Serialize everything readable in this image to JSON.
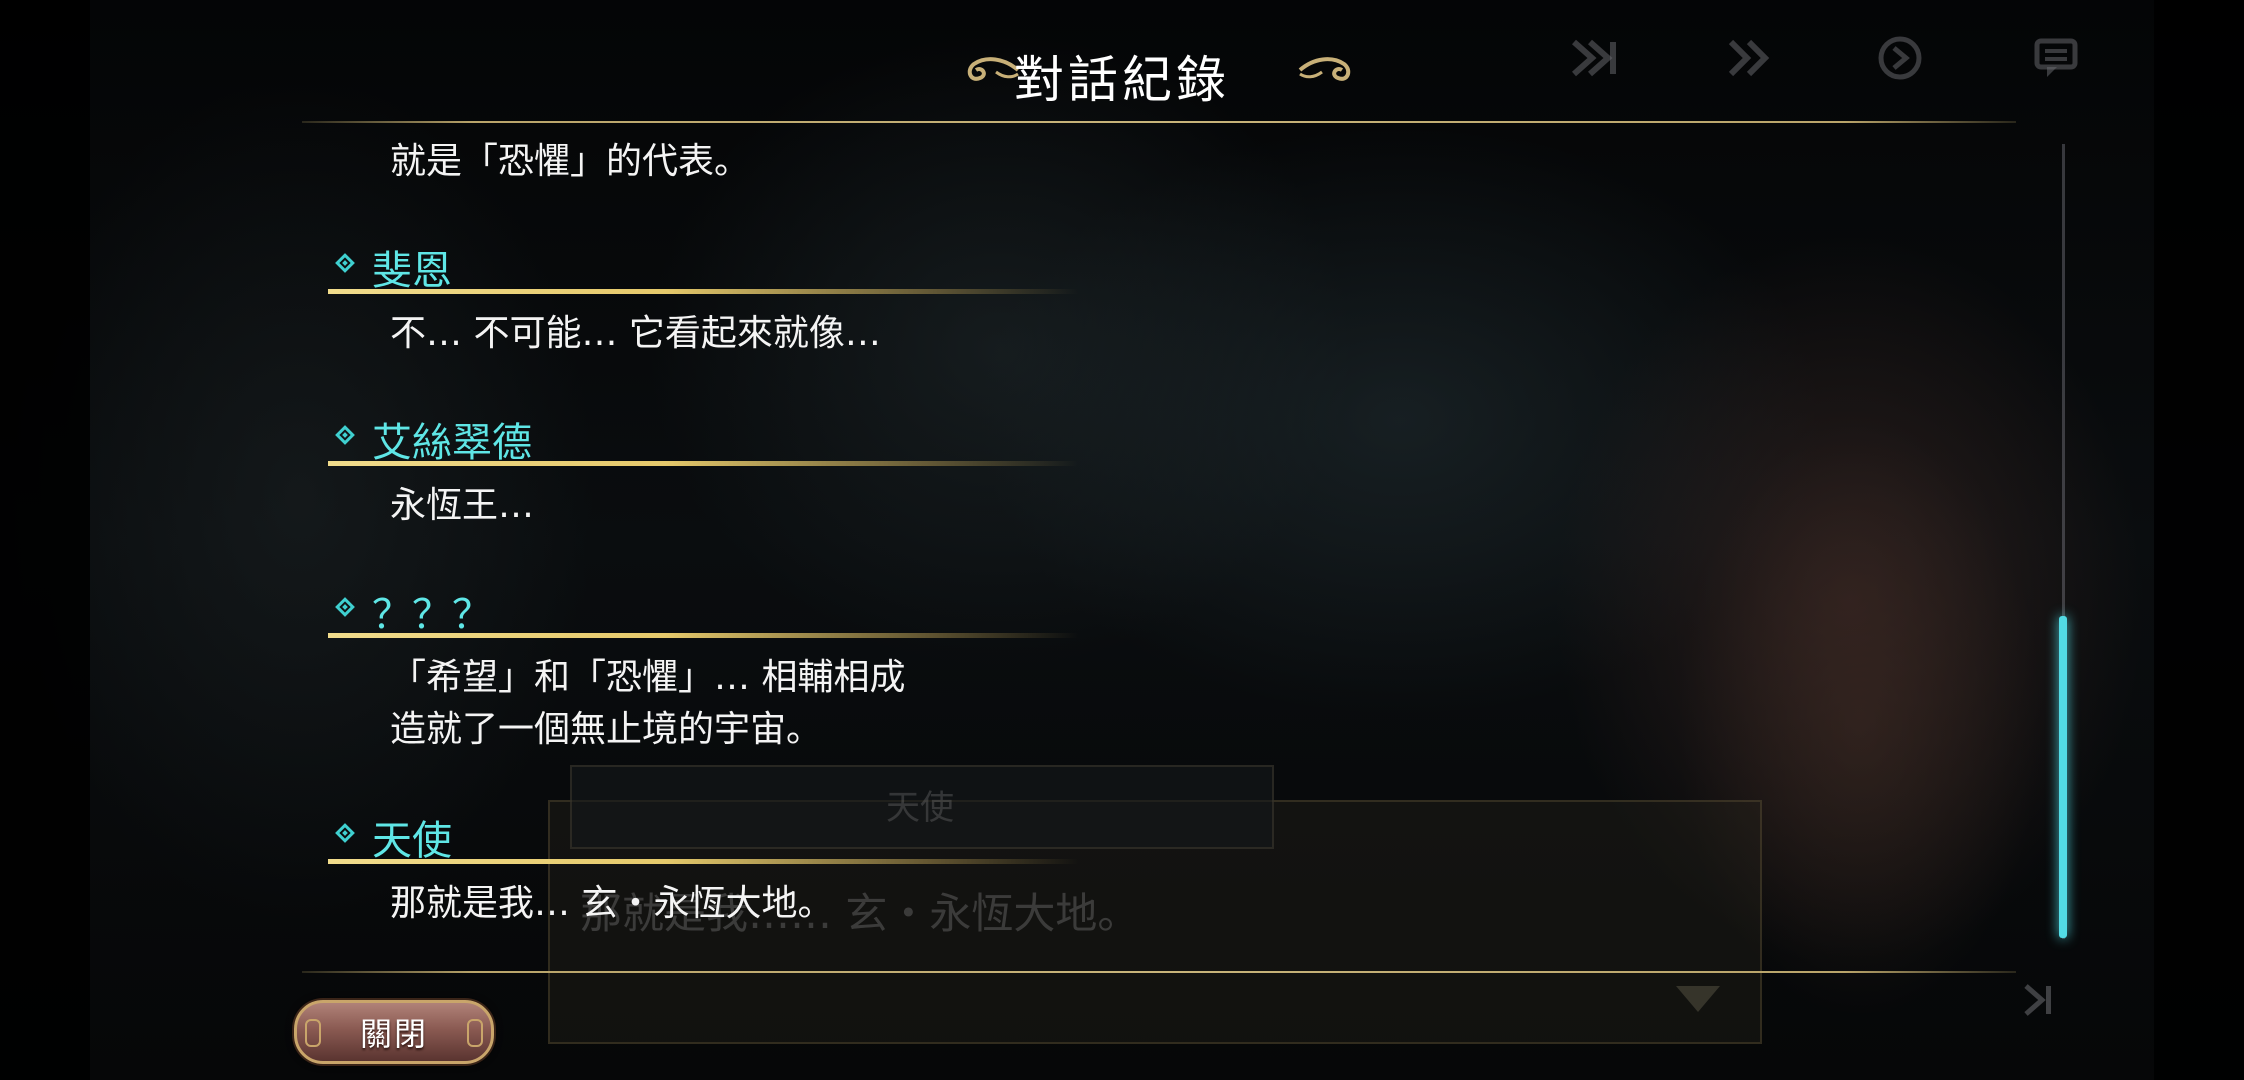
{
  "header": {
    "title": "對話紀錄"
  },
  "background_dialog": {
    "speaker": "天使",
    "text": "那就是我…… 玄・永恆大地。"
  },
  "top_controls": [
    {
      "icon": "fast-forward-icon",
      "glyph": "⏭"
    },
    {
      "icon": "skip-forward-icon",
      "glyph": "»"
    },
    {
      "icon": "auto-play-icon",
      "glyph": "⟳"
    },
    {
      "icon": "log-icon",
      "glyph": "☰"
    }
  ],
  "log": {
    "entries": [
      {
        "speaker": "",
        "lines": [
          "就是「恐懼」的代表。"
        ]
      },
      {
        "speaker": "斐恩",
        "lines": [
          "不… 不可能… 它看起來就像…"
        ]
      },
      {
        "speaker": "艾絲翠德",
        "lines": [
          "永恆王…"
        ]
      },
      {
        "speaker": "？？？",
        "lines": [
          "「希望」和「恐懼」… 相輔相成",
          "造就了一個無止境的宇宙。"
        ]
      },
      {
        "speaker": "天使",
        "lines": [
          "那就是我… 玄・永恆大地。"
        ]
      }
    ]
  },
  "scrollbar": {
    "position_fraction": 0.6
  },
  "footer": {
    "close_label": "關閉"
  },
  "colors": {
    "speaker_name": "#5fe6e6",
    "accent_gold": "#e5c96b",
    "scroll_thumb": "#52dbe5"
  }
}
